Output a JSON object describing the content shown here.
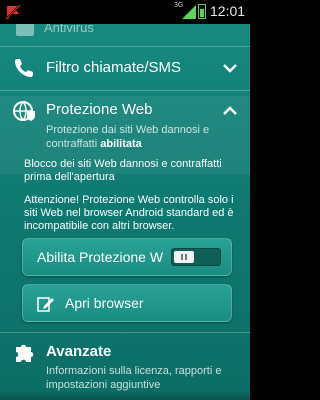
{
  "status_bar": {
    "network": "3G",
    "time": "12:01",
    "notification_icon": "flag-icon",
    "accent": "#5fd15f"
  },
  "menu": {
    "previous_item_label": "Antivirus",
    "call_filter": {
      "title": "Filtro chiamate/SMS",
      "icon": "phone-icon",
      "expanded": false
    },
    "web_protection": {
      "title": "Protezione Web",
      "icon": "globe-shield-icon",
      "description": "Protezione dai siti Web dannosi e contraffatti",
      "status": "abilitata",
      "expanded": true,
      "info_text": "Blocco dei siti Web dannosi e contraffatti prima dell'apertura",
      "warning_text": "Attenzione! Protezione Web controlla solo i siti Web nel browser Android standard ed è incompatibile con altri browser.",
      "toggle_button_label": "Abilita Protezione W",
      "toggle_on": true,
      "open_browser_label": "Apri browser"
    },
    "advanced": {
      "title": "Avanzate",
      "icon": "puzzle-icon",
      "description": "Informazioni sulla licenza, rapporti e impostazioni aggiuntive"
    }
  },
  "colors": {
    "background_top": "#17897f",
    "background_bottom": "#0b6e66",
    "button": "#1f968b"
  }
}
